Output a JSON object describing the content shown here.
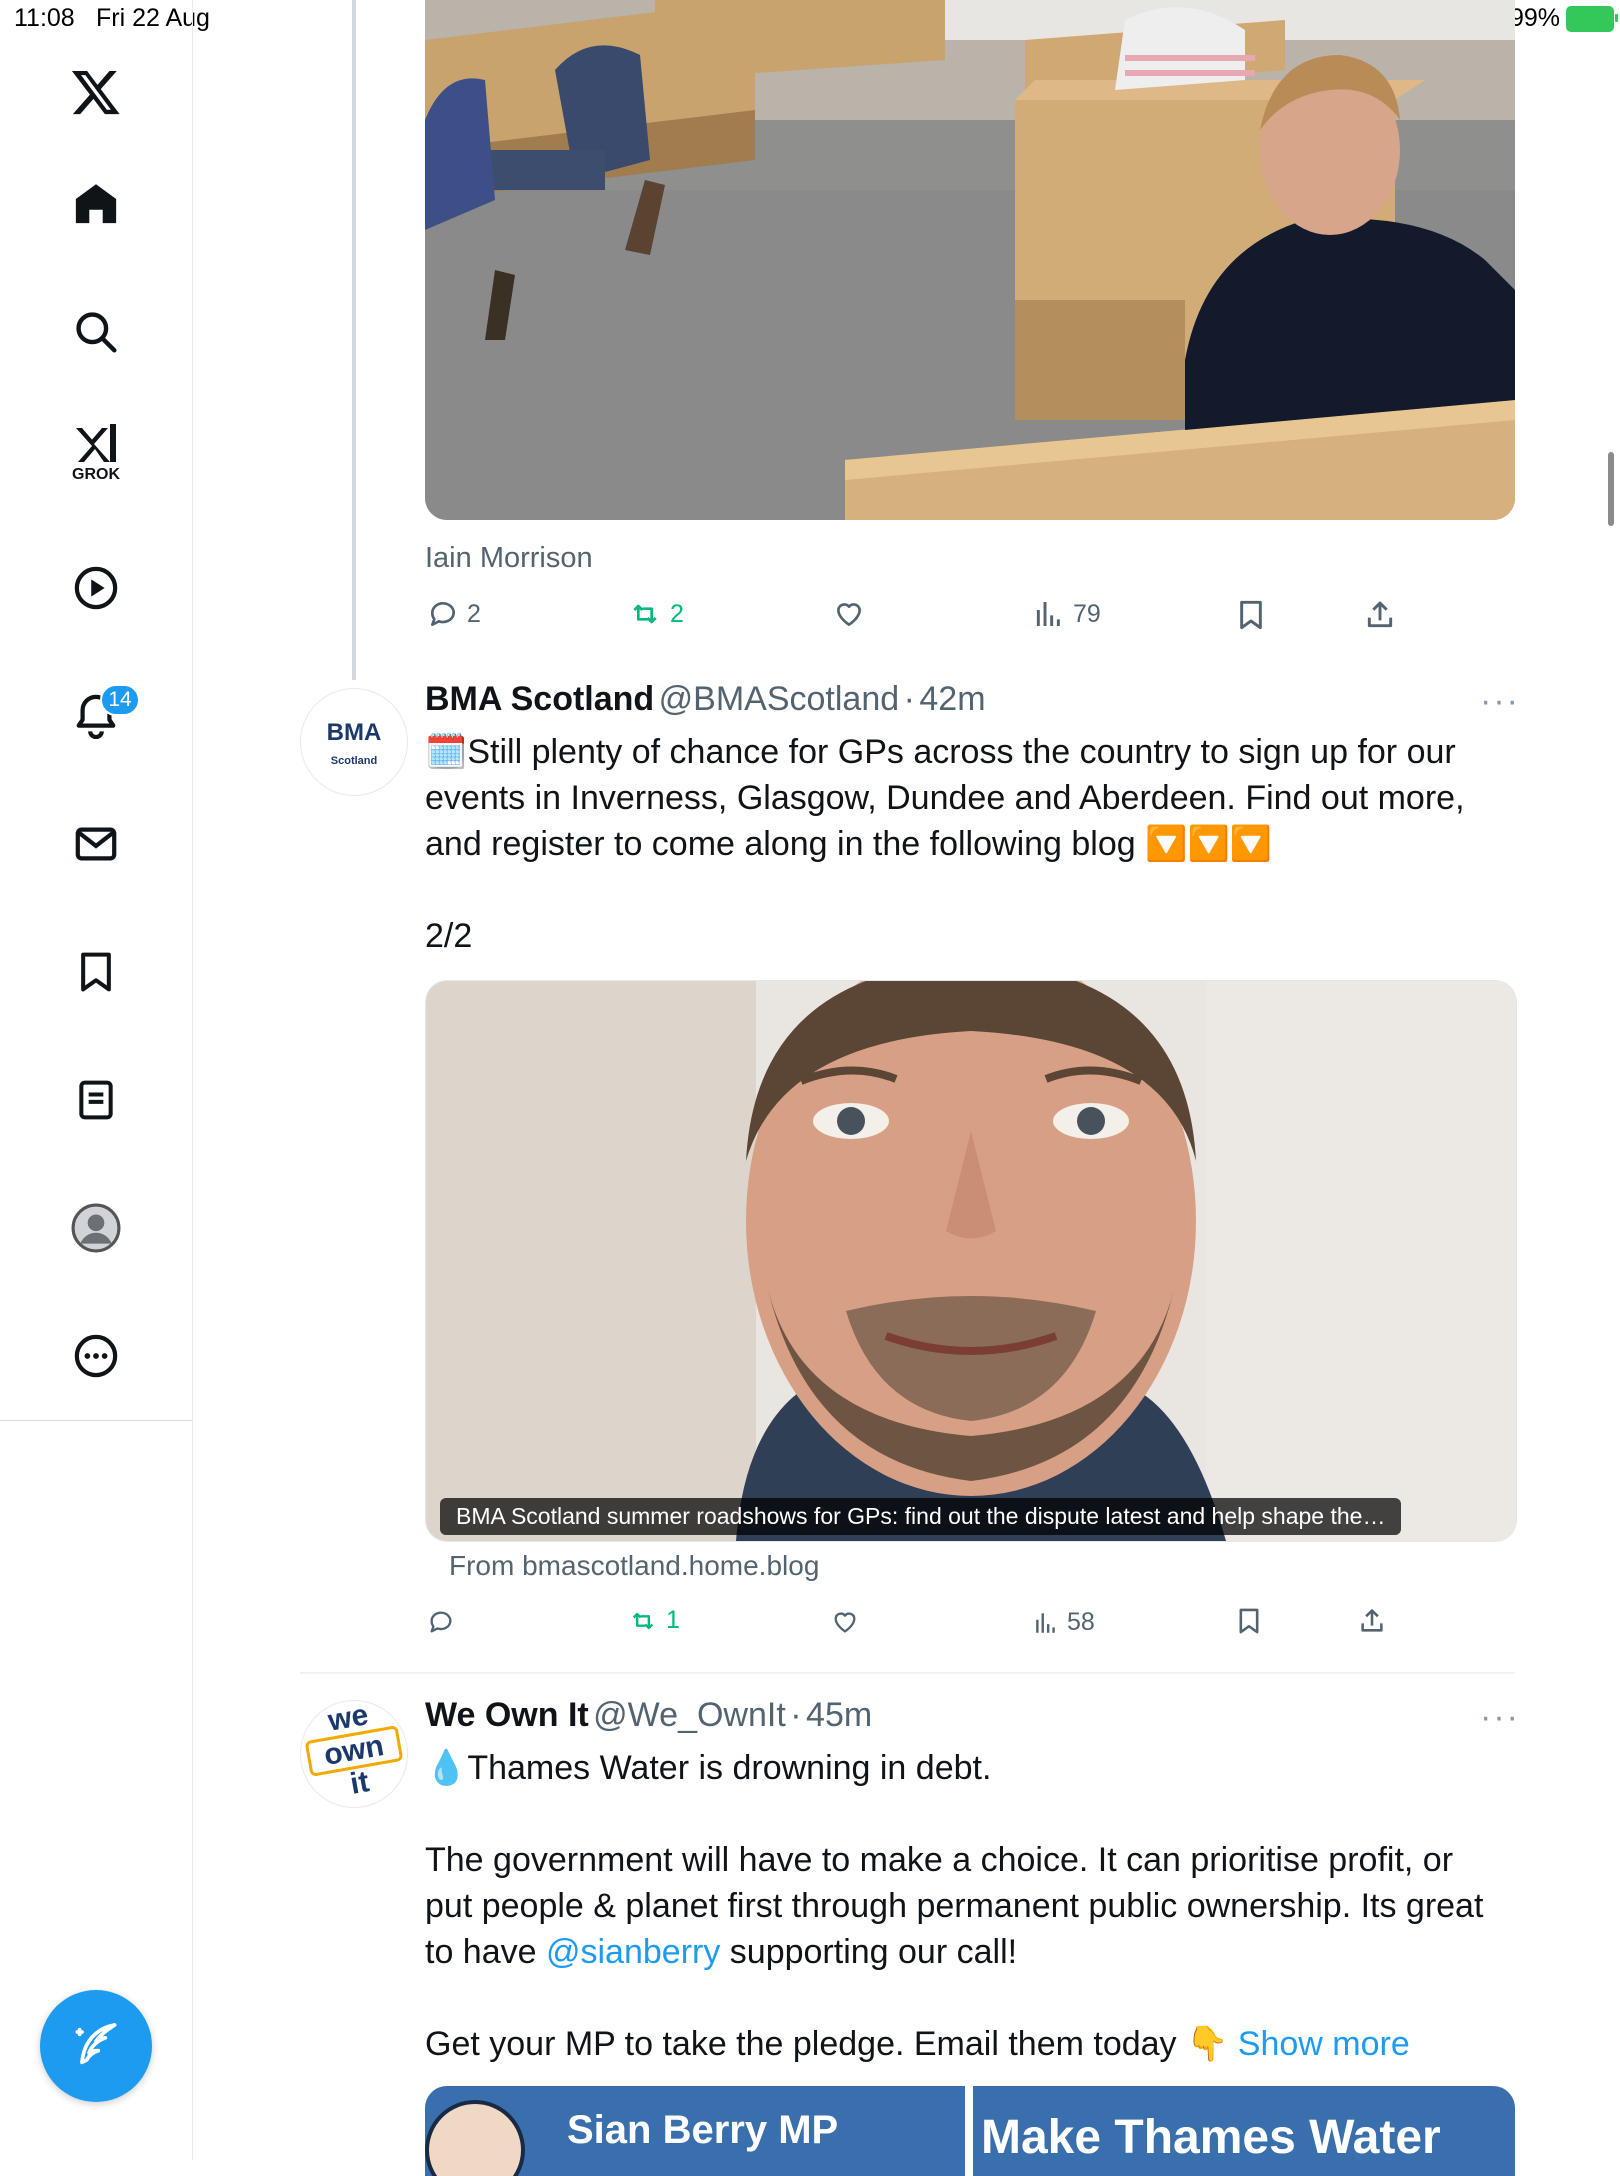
{
  "status_bar": {
    "time": "11:08",
    "date": "Fri 22 Aug",
    "battery": "99%"
  },
  "sidebar": {
    "logo": "x-logo-icon",
    "items": [
      {
        "icon": "home-icon"
      },
      {
        "icon": "search-icon"
      },
      {
        "icon": "grok-icon",
        "label": "GROK"
      },
      {
        "icon": "video-play-icon"
      },
      {
        "icon": "bell-icon",
        "badge": "14"
      },
      {
        "icon": "mail-icon"
      },
      {
        "icon": "bookmark-icon"
      },
      {
        "icon": "lists-icon"
      },
      {
        "icon": "profile-avatar-icon"
      },
      {
        "icon": "more-circle-icon"
      }
    ],
    "compose_icon": "compose-post-icon"
  },
  "prev_post": {
    "image_caption": "Iain Morrison",
    "replies": "2",
    "reposts": "2",
    "views": "79"
  },
  "post1": {
    "name": "BMA Scotland",
    "handle": "@BMAScotland",
    "sep": "·",
    "time": "42m",
    "more": "···",
    "avatar_text": "BMA",
    "avatar_sub": "Scotland",
    "text_line1": "🗓️Still plenty of chance for GPs across the country to sign up for our",
    "text_line2": "events in Inverness, Glasgow, Dundee and Aberdeen. Find out more,",
    "text_line3": "and register to come along in the following blog 🔽🔽🔽",
    "text_line4": "2/2",
    "card_title": "BMA Scotland summer roadshows for GPs: find out the dispute latest and help shape the…",
    "card_source": "From bmascotland.home.blog",
    "replies": "",
    "reposts": "1",
    "views": "58"
  },
  "post2": {
    "name": "We Own It",
    "handle": "@We_OwnIt",
    "sep": "·",
    "time": "45m",
    "more": "···",
    "avatar_l1": "we",
    "avatar_l2": "own",
    "avatar_l3": "it",
    "line1": "💧Thames Water is drowning in debt.",
    "line2": "The government will have to make a choice. It can prioritise profit, or",
    "line3": "put people & planet first through permanent public ownership. Its great",
    "line4_pre": "to have ",
    "line4_mention": "@sianberry",
    "line4_post": " supporting our call!",
    "line5": "Get your MP to take the pledge. Email them today 👇",
    "show_more": "Show more",
    "img_left_text": "Sian Berry MP",
    "img_right_text": "Make Thames Water"
  }
}
